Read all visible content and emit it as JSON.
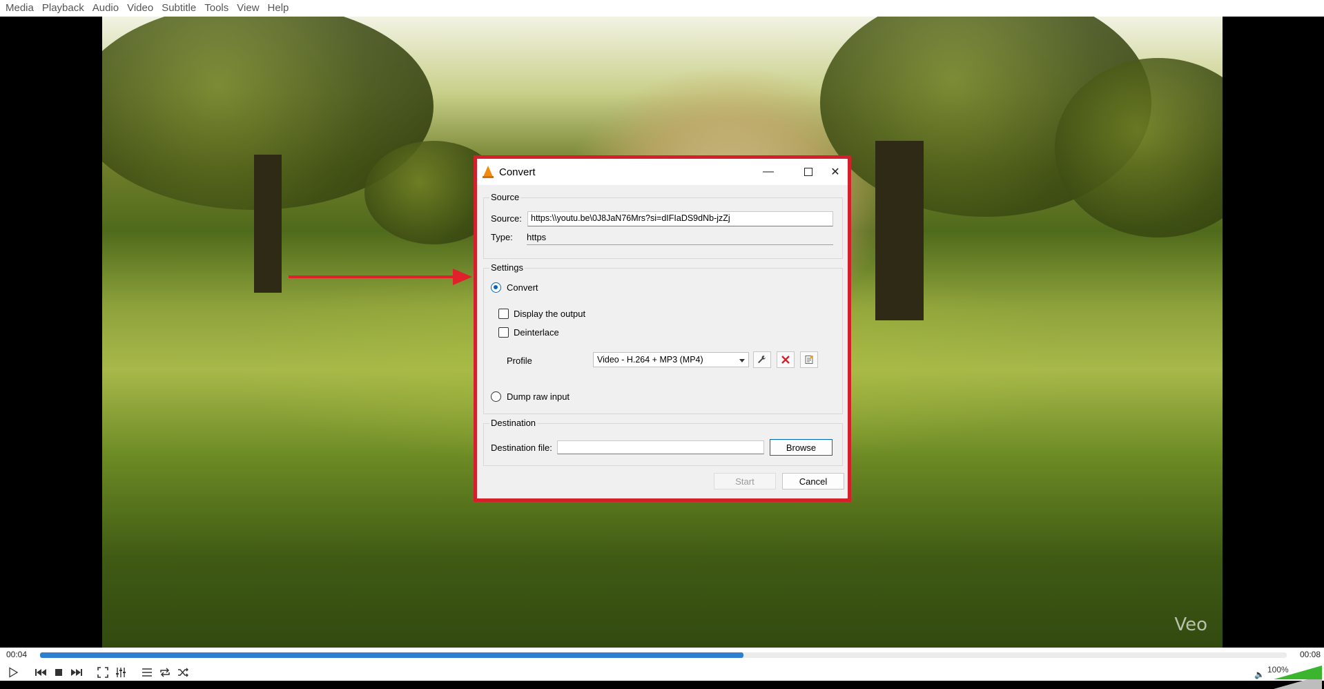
{
  "menubar": {
    "items": [
      "Media",
      "Playback",
      "Audio",
      "Video",
      "Subtitle",
      "Tools",
      "View",
      "Help"
    ]
  },
  "video": {
    "watermark": "Veo"
  },
  "dialog": {
    "title": "Convert",
    "window_buttons": {
      "minimize": "—",
      "close": "✕"
    },
    "source": {
      "group_title": "Source",
      "source_label": "Source:",
      "source_value": "https:\\\\youtu.be\\0J8JaN76Mrs?si=dIFIaDS9dNb-jzZj",
      "type_label": "Type:",
      "type_value": "https"
    },
    "settings": {
      "group_title": "Settings",
      "convert_label": "Convert",
      "convert_selected": true,
      "display_output_label": "Display the output",
      "display_output_checked": false,
      "deinterlace_label": "Deinterlace",
      "deinterlace_checked": false,
      "profile_label": "Profile",
      "profile_value": "Video - H.264 + MP3 (MP4)",
      "dump_raw_label": "Dump raw input",
      "dump_raw_selected": false
    },
    "destination": {
      "group_title": "Destination",
      "file_label": "Destination file:",
      "file_value": "",
      "browse_label": "Browse"
    },
    "start_label": "Start",
    "cancel_label": "Cancel"
  },
  "controls": {
    "time_elapsed": "00:04",
    "time_total": "00:08",
    "progress_fraction": 0.564,
    "volume_label": "100%",
    "volume_fraction": 1.0
  },
  "colors": {
    "highlight_red": "#e0202a",
    "accent_blue": "#0067c0",
    "seek_blue": "#2f7fd0",
    "volume_green": "#3bb52d"
  }
}
